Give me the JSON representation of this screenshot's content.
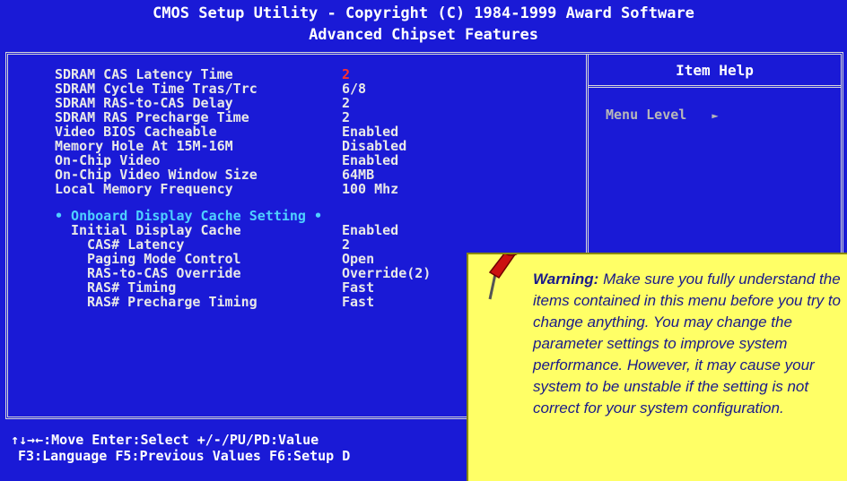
{
  "header": {
    "title": "CMOS Setup Utility - Copyright (C) 1984-1999 Award Software",
    "subtitle": "Advanced Chipset Features"
  },
  "settings": [
    {
      "label": "SDRAM CAS Latency Time",
      "value": "2",
      "highlighted": true
    },
    {
      "label": "SDRAM Cycle Time Tras/Trc",
      "value": "6/8"
    },
    {
      "label": "SDRAM RAS-to-CAS Delay",
      "value": "2"
    },
    {
      "label": "SDRAM RAS Precharge Time",
      "value": "2"
    },
    {
      "label": "Video BIOS Cacheable",
      "value": "Enabled"
    },
    {
      "label": "Memory Hole At 15M-16M",
      "value": "Disabled"
    },
    {
      "label": "On-Chip Video",
      "value": "Enabled"
    },
    {
      "label": "On-Chip Video Window Size",
      "value": "64MB"
    },
    {
      "label": "Local Memory Frequency",
      "value": "100 Mhz"
    }
  ],
  "section": {
    "title": "• Onboard Display Cache Setting •",
    "items": [
      {
        "label": "Initial Display Cache",
        "value": "Enabled"
      },
      {
        "label": "CAS# Latency",
        "value": "2"
      },
      {
        "label": "Paging Mode Control",
        "value": "Open"
      },
      {
        "label": "RAS-to-CAS Override",
        "value": "Override(2)"
      },
      {
        "label": "RAS# Timing",
        "value": "Fast"
      },
      {
        "label": "RAS# Precharge Timing",
        "value": "Fast"
      }
    ]
  },
  "help": {
    "title": "Item Help",
    "menu_level_label": "Menu Level",
    "menu_level_arrow": "►"
  },
  "footer": {
    "line1": "↑↓→←:Move  Enter:Select  +/-/PU/PD:Value",
    "line2": "F3:Language F5:Previous Values F6:Setup D"
  },
  "note": {
    "warning_label": "Warning:",
    "warning_text": " Make sure you fully understand the items contained in this menu before you try to change anything. You may change the parameter settings to improve system performance. However, it may cause your system to be unstable if the setting is not correct for your system configuration."
  },
  "colors": {
    "background": "#1a1ad6",
    "highlight": "#ff3030",
    "section": "#4fd0ff",
    "note_bg": "#ffff66",
    "note_text": "#1a1a8a"
  },
  "icons": {
    "note_pin": "pushpin-icon"
  }
}
